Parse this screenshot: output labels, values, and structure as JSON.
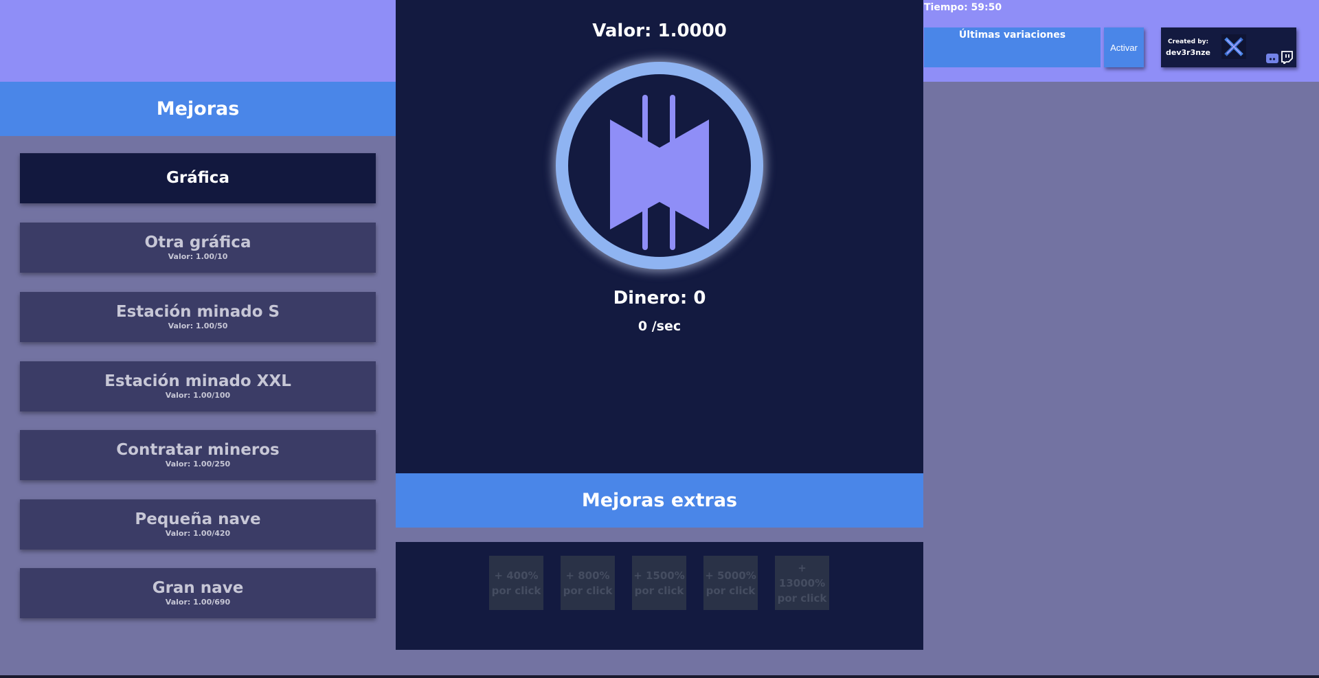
{
  "timer": {
    "label": "Tiempo: 59:50"
  },
  "variaciones": {
    "title": "Últimas variaciones"
  },
  "activar": {
    "label": "Activar"
  },
  "credits": {
    "label": "Created by:",
    "name": "dev3r3nze"
  },
  "left_panel": {
    "title": "Mejoras",
    "items": [
      {
        "name": "Gráfica",
        "value": "",
        "active": true
      },
      {
        "name": "Otra gráfica",
        "value": "Valor: 1.00/10",
        "active": false
      },
      {
        "name": "Estación minado S",
        "value": "Valor: 1.00/50",
        "active": false
      },
      {
        "name": "Estación minado XXL",
        "value": "Valor: 1.00/100",
        "active": false
      },
      {
        "name": "Contratar mineros",
        "value": "Valor: 1.00/250",
        "active": false
      },
      {
        "name": "Pequeña nave",
        "value": "Valor: 1.00/420",
        "active": false
      },
      {
        "name": "Gran nave",
        "value": "Valor: 1.00/690",
        "active": false
      }
    ]
  },
  "center": {
    "valor": "Valor: 1.0000",
    "dinero": "Dinero: 0",
    "rate": "0 /sec"
  },
  "extras": {
    "title": "Mejoras extras",
    "items": [
      {
        "amount": "+ 400%",
        "unit": "por click"
      },
      {
        "amount": "+ 800%",
        "unit": "por click"
      },
      {
        "amount": "+ 1500%",
        "unit": "por click"
      },
      {
        "amount": "+ 5000%",
        "unit": "por click"
      },
      {
        "amount": "+ 13000%",
        "unit": "por click"
      }
    ]
  },
  "colors": {
    "top_band": "#8f8ef7",
    "background": "#7373a2",
    "panel_dark": "#131a40",
    "accent_blue": "#4a86e8",
    "upgrade_button": "#3b3c66",
    "coin_ring": "#8fb4f2",
    "coin_symbol": "#8f8ef7"
  },
  "icons": {
    "coin": "bitcoin-style-coin-icon",
    "logo": "crossed-x-logo-icon",
    "discord": "discord-icon",
    "twitch": "twitch-icon"
  }
}
